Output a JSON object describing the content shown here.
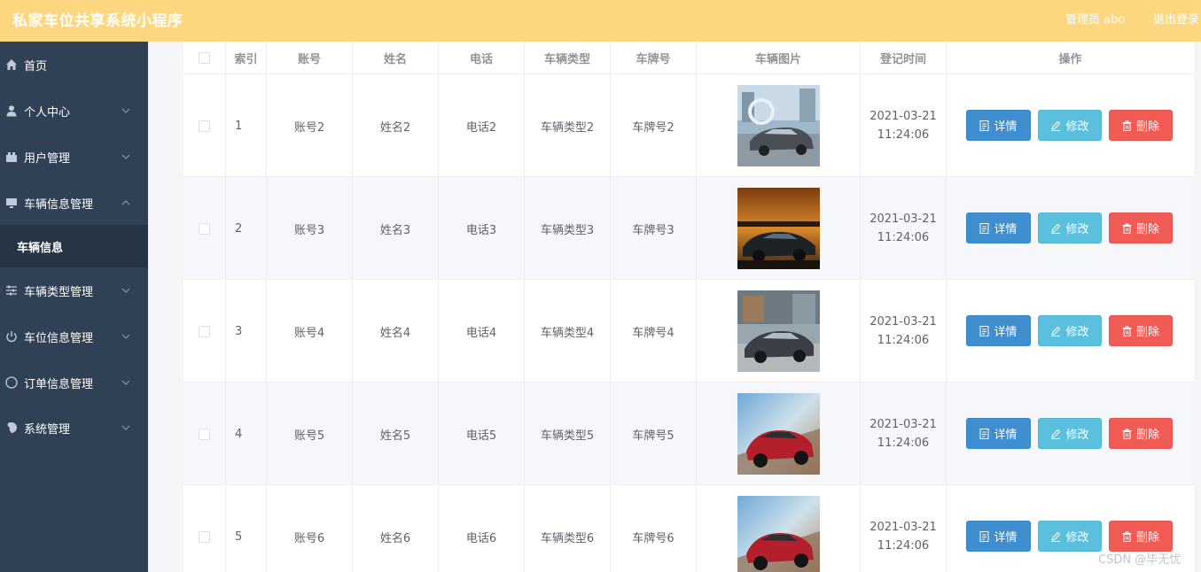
{
  "header": {
    "title": "私家车位共享系统小程序",
    "admin": "管理员 abo",
    "logout": "退出登录",
    "background": "#fdd77f"
  },
  "sidebar": {
    "background": "#304156",
    "items": [
      {
        "label": "首页",
        "icon": "home-icon",
        "expandable": false
      },
      {
        "label": "个人中心",
        "icon": "user-icon",
        "expandable": true
      },
      {
        "label": "用户管理",
        "icon": "users-icon",
        "expandable": true
      },
      {
        "label": "车辆信息管理",
        "icon": "monitor-icon",
        "expandable": true,
        "expanded": true
      },
      {
        "label": "车辆类型管理",
        "icon": "sliders-icon",
        "expandable": true
      },
      {
        "label": "车位信息管理",
        "icon": "power-icon",
        "expandable": true
      },
      {
        "label": "订单信息管理",
        "icon": "compass-icon",
        "expandable": true
      },
      {
        "label": "系统管理",
        "icon": "settings-icon",
        "expandable": true
      }
    ],
    "submenu": {
      "label": "车辆信息",
      "parent": "车辆信息管理",
      "active": true
    }
  },
  "table": {
    "columns": [
      "索引",
      "账号",
      "姓名",
      "电话",
      "车辆类型",
      "车牌号",
      "车辆图片",
      "登记时间",
      "操作"
    ],
    "rows": [
      {
        "index": "1",
        "account": "账号2",
        "name": "姓名2",
        "phone": "电话2",
        "type": "车辆类型2",
        "plate": "车牌号2",
        "date": "2021-03-21",
        "time": "11:24:06",
        "image": "car-photo-silver-sedan"
      },
      {
        "index": "2",
        "account": "账号3",
        "name": "姓名3",
        "phone": "电话3",
        "type": "车辆类型3",
        "plate": "车牌号3",
        "date": "2021-03-21",
        "time": "11:24:06",
        "image": "car-photo-black-sports-sunset"
      },
      {
        "index": "3",
        "account": "账号4",
        "name": "姓名4",
        "phone": "电话4",
        "type": "车辆类型4",
        "plate": "车牌号4",
        "date": "2021-03-21",
        "time": "11:24:06",
        "image": "car-photo-gray-sedan"
      },
      {
        "index": "4",
        "account": "账号5",
        "name": "姓名5",
        "phone": "电话5",
        "type": "车辆类型5",
        "plate": "车牌号5",
        "date": "2021-03-21",
        "time": "11:24:06",
        "image": "car-photo-red-suv"
      },
      {
        "index": "5",
        "account": "账号6",
        "name": "姓名6",
        "phone": "电话6",
        "type": "车辆类型6",
        "plate": "车牌号6",
        "date": "2021-03-21",
        "time": "11:24:06",
        "image": "car-photo-red-suv"
      }
    ],
    "actions": {
      "detail": "详情",
      "edit": "修改",
      "delete": "删除"
    },
    "colors": {
      "detail": "#3e8ed0",
      "edit": "#5bc0de",
      "delete": "#f15b56"
    }
  },
  "watermark": "CSDN @毕无忧"
}
